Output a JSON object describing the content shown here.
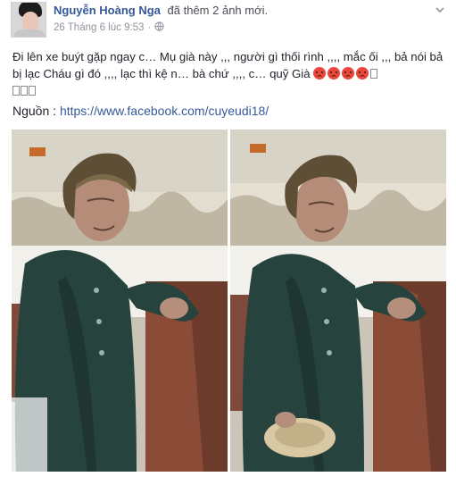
{
  "post": {
    "author": "Nguyễn Hoàng Nga",
    "action": "đã thêm 2 ảnh mới.",
    "timestamp": "26 Tháng 6 lúc 9:53",
    "separator": "·",
    "text": "Đi lên xe buýt gặp ngay c… Mụ già này ,,, người gì thối rình ,,,, mắc ối ,,, bả nói bả bị lạc Cháu gì đó ,,,, lạc thì kệ n… bà chứ ,,,, c… quỹ Già",
    "emoji_count": 4,
    "source_label": "Nguồn :",
    "source_url": "https://www.facebook.com/cuyeudi18/"
  },
  "icons": {
    "options": "chevron-down-icon",
    "privacy": "globe-icon",
    "reaction": "angry-face-icon"
  },
  "photos": [
    {
      "name": "photo-left",
      "subject": "elderly woman on bus"
    },
    {
      "name": "photo-right",
      "subject": "elderly woman on bus"
    }
  ],
  "colors": {
    "link": "#365899",
    "meta": "#90949c",
    "text": "#1d2129",
    "emoji": "#e9473c"
  }
}
